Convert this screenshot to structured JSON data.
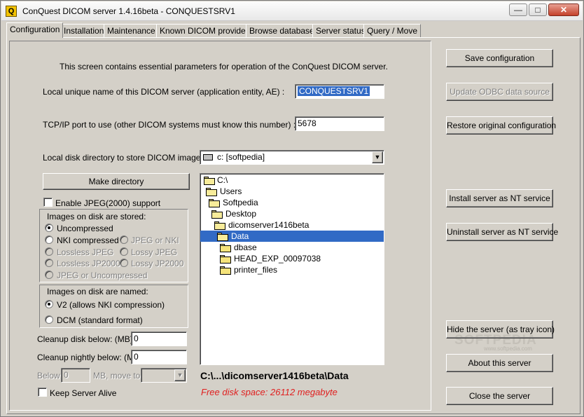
{
  "window": {
    "title": "ConQuest DICOM server 1.4.16beta - CONQUESTSRV1",
    "app_icon_letter": "Q"
  },
  "tabs": [
    "Configuration",
    "Installation",
    "Maintenance",
    "Known DICOM providers",
    "Browse database",
    "Server status",
    "Query / Move"
  ],
  "intro": "This screen contains essential parameters for operation of the ConQuest DICOM server.",
  "ae": {
    "label": "Local unique name of this DICOM server (application entity, AE) :",
    "value": "CONQUESTSRV1"
  },
  "port": {
    "label": "TCP/IP port to use (other DICOM systems must know this number) :",
    "value": "5678"
  },
  "disk": {
    "label": "Local disk directory to store DICOM images :",
    "drive": "c: [softpedia]"
  },
  "make_directory": "Make directory",
  "jpeg_support": "Enable JPEG(2000) support",
  "stored": {
    "title": "Images on disk are stored:",
    "options": [
      "Uncompressed",
      "NKI compressed",
      "JPEG or NKI",
      "Lossless JPEG",
      "Lossy JPEG",
      "Lossless JP2000",
      "Lossy JP2000",
      "JPEG or Uncompressed"
    ]
  },
  "named": {
    "title": "Images on disk are named:",
    "options": [
      "V2 (allows NKI compression)",
      "DCM (standard format)"
    ]
  },
  "cleanup": {
    "disk_label": "Cleanup disk below: (MB)",
    "disk_value": "0",
    "nightly_label": "Cleanup nightly below: (MB)",
    "nightly_value": "0",
    "below_label": "Below",
    "below_value": "0",
    "move_label": "MB, move to:"
  },
  "keep_alive": "Keep Server Alive",
  "tree": [
    "C:\\",
    "Users",
    "Softpedia",
    "Desktop",
    "dicomserver1416beta",
    "Data",
    "dbase",
    "HEAD_EXP_00097038",
    "printer_files"
  ],
  "path": "C:\\...\\dicomserver1416beta\\Data",
  "free_space": "Free disk space: 26112 megabyte",
  "buttons": {
    "save": "Save configuration",
    "update": "Update ODBC data source",
    "restore": "Restore original configuration",
    "install": "Install server as NT service",
    "uninstall": "Uninstall server as NT service",
    "hide": "Hide the server (as tray icon)",
    "about": "About this server",
    "close": "Close the server"
  },
  "watermark": "SOFTPEDIA",
  "watermark_url": "www.softpedia.com",
  "colors": {
    "selection": "#316ac5",
    "free_space": "#e02020"
  }
}
